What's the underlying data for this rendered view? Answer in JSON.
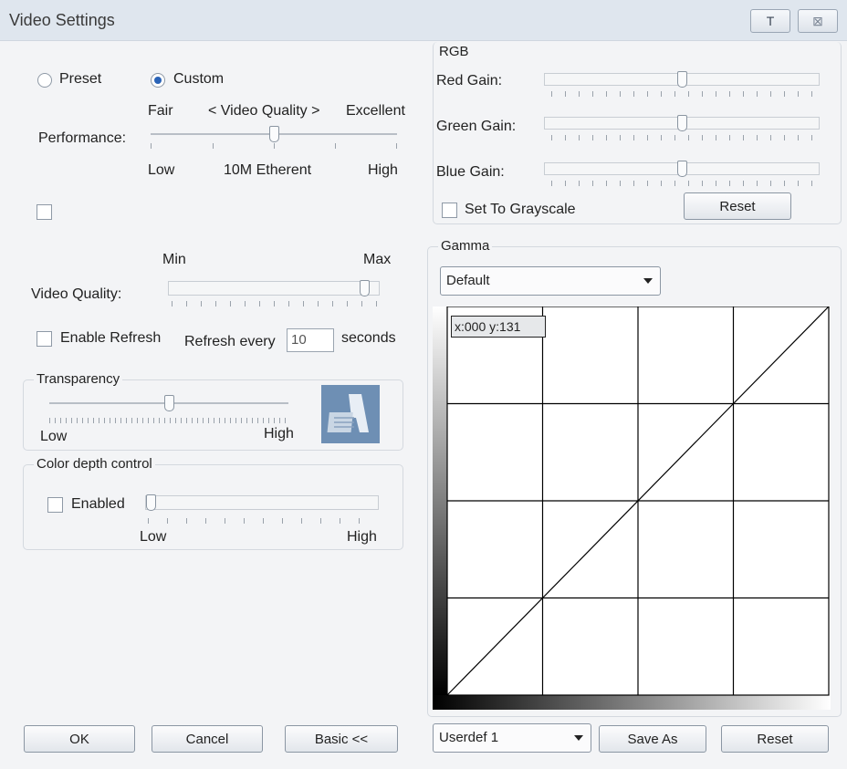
{
  "window": {
    "title": "Video Settings",
    "pin_label": "T",
    "close_label": "⊠"
  },
  "mode": {
    "preset_label": "Preset",
    "custom_label": "Custom",
    "selected": "Custom"
  },
  "performance": {
    "label": "Performance:",
    "top_left": "Fair",
    "top_center": "< Video Quality >",
    "top_right": "Excellent",
    "bottom_left": "Low",
    "bottom_center": "10M Etherent",
    "bottom_right": "High",
    "level": 0.5
  },
  "unnamed_checkbox": {
    "checked": false
  },
  "video_quality": {
    "label": "Video Quality:",
    "min_label": "Min",
    "max_label": "Max",
    "level": 0.95
  },
  "refresh": {
    "enable_label": "Enable Refresh",
    "every_label": "Refresh every",
    "value": "10",
    "unit_label": "seconds",
    "enabled": false
  },
  "transparency": {
    "group_label": "Transparency",
    "low_label": "Low",
    "high_label": "High",
    "level": 0.5
  },
  "color_depth": {
    "group_label": "Color depth control",
    "enabled_label": "Enabled",
    "low_label": "Low",
    "high_label": "High",
    "enabled": false,
    "level": 0.0
  },
  "buttons": {
    "ok": "OK",
    "cancel": "Cancel",
    "basic": "Basic <<"
  },
  "rgb": {
    "group_label": "RGB",
    "red_label": "Red Gain:",
    "green_label": "Green Gain:",
    "blue_label": "Blue Gain:",
    "red_level": 0.5,
    "green_level": 0.5,
    "blue_level": 0.5,
    "grayscale_label": "Set To Grayscale",
    "grayscale_checked": false,
    "reset_label": "Reset"
  },
  "gamma": {
    "group_label": "Gamma",
    "selected": "Default",
    "readout": "x:000 y:131",
    "userdef_selected": "Userdef 1",
    "save_as_label": "Save As",
    "reset_label": "Reset"
  }
}
